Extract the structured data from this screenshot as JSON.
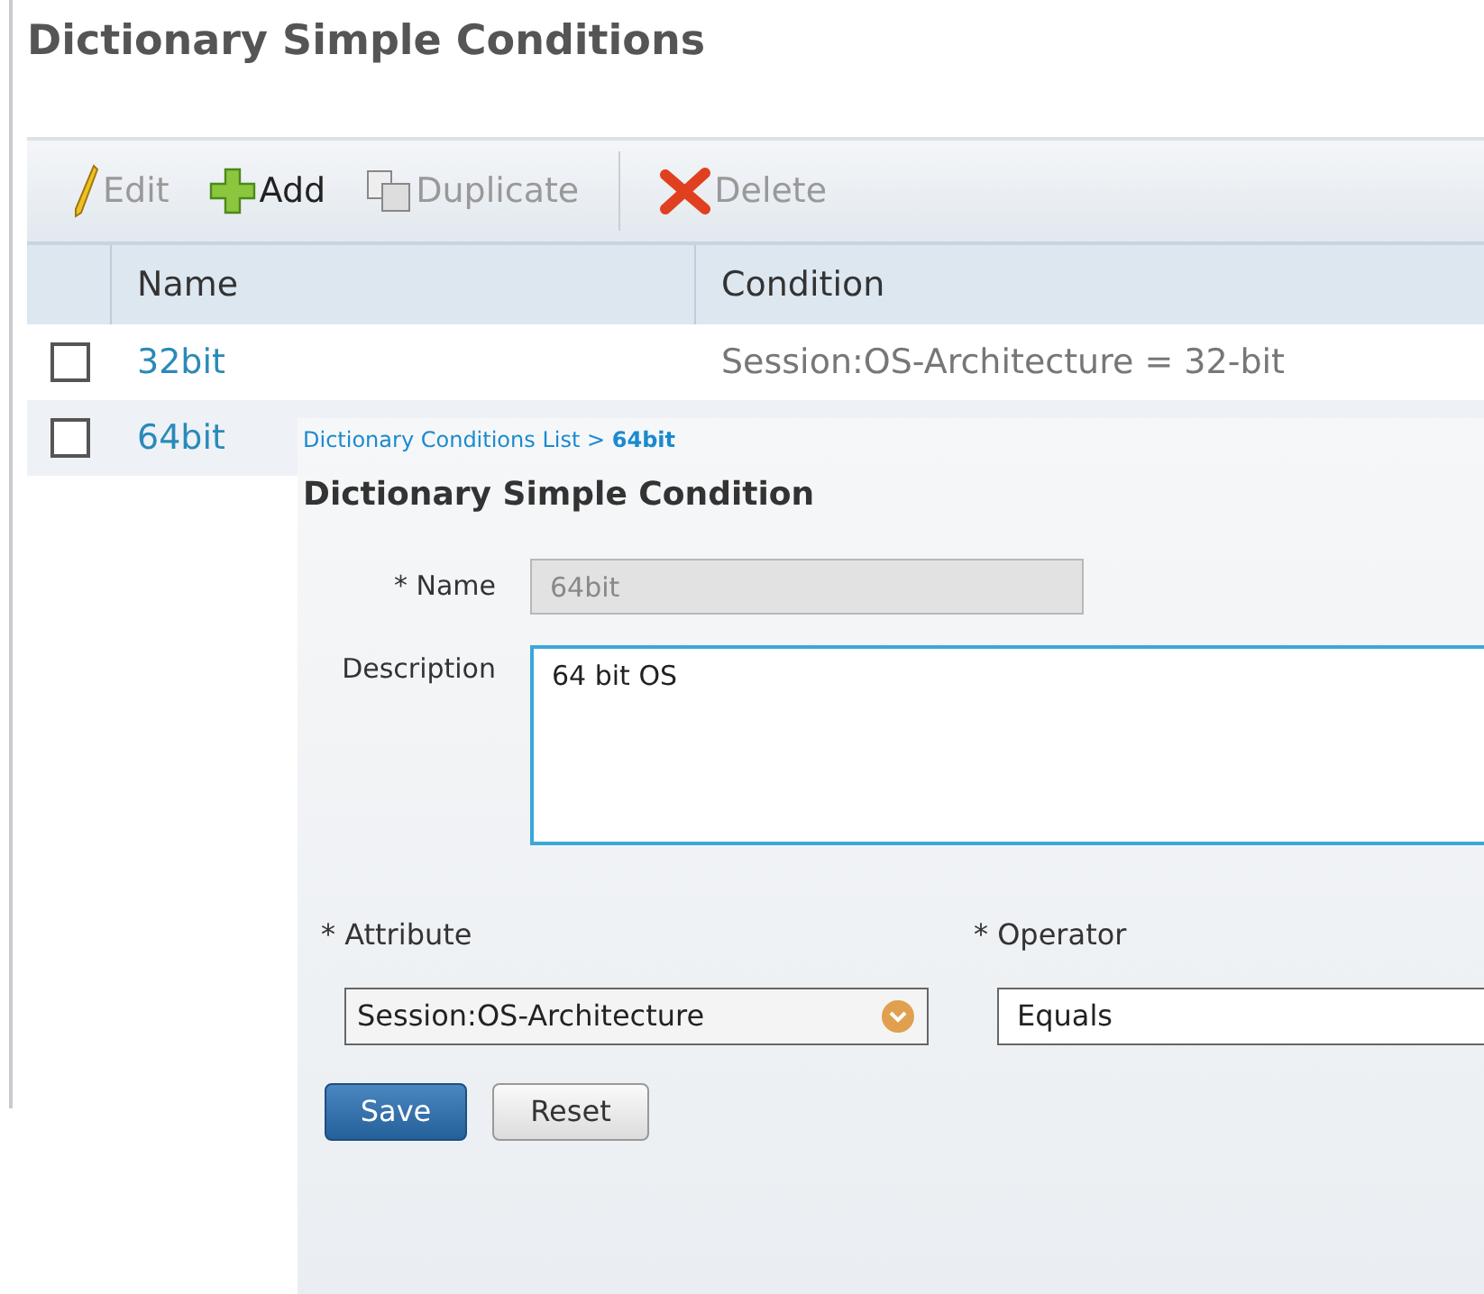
{
  "page_title": "Dictionary Simple Conditions",
  "toolbar": [
    {
      "kind": "edit",
      "label": "Edit",
      "disabled": true
    },
    {
      "kind": "add",
      "label": "Add",
      "disabled": false
    },
    {
      "kind": "duplicate",
      "label": "Duplicate",
      "disabled": true
    },
    {
      "kind": "delete",
      "label": "Delete",
      "disabled": true
    }
  ],
  "table": {
    "columns": [
      "Name",
      "Condition"
    ],
    "rows": [
      {
        "checked": false,
        "name": "32bit",
        "condition": "Session:OS-Architecture = 32-bit"
      },
      {
        "checked": false,
        "name": "64bit"
      }
    ]
  },
  "detail": {
    "breadcrumb": {
      "parent": "Dictionary Conditions List >",
      "current": "64bit"
    },
    "title": "Dictionary Simple Condition",
    "name": {
      "label": "* Name",
      "value": "64bit",
      "disabled": true
    },
    "description": {
      "label": "Description",
      "value": "64 bit OS"
    },
    "attribute": {
      "label": "* Attribute",
      "value": "Session:OS-Architecture"
    },
    "operator": {
      "label": "* Operator",
      "value": "Equals"
    },
    "buttons": [
      {
        "kind": "primary",
        "label": "Save"
      },
      {
        "kind": "secondary",
        "label": "Reset"
      }
    ]
  }
}
